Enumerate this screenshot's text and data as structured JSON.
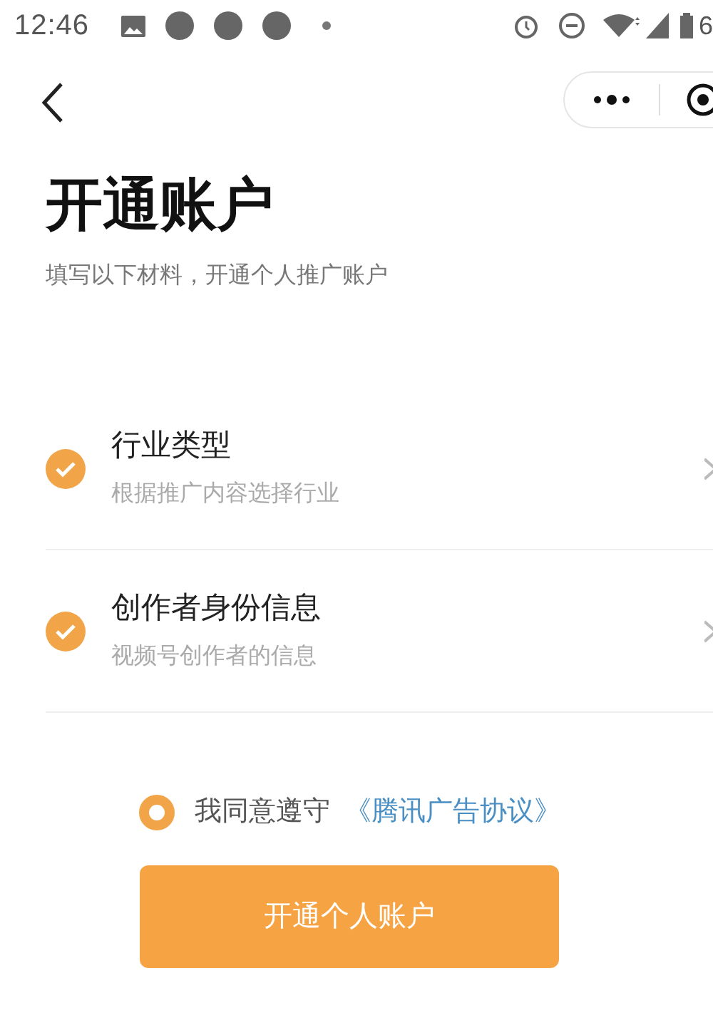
{
  "status_bar": {
    "time": "12:46",
    "battery_text": "6"
  },
  "header": {
    "title": "开通账户",
    "subtitle": "填写以下材料，开通个人推广账户"
  },
  "items": [
    {
      "title": "行业类型",
      "description": "根据推广内容选择行业",
      "checked": true
    },
    {
      "title": "创作者身份信息",
      "description": "视频号创作者的信息",
      "checked": true
    }
  ],
  "agreement": {
    "text": "我同意遵守",
    "link": "《腾讯广告协议》",
    "selected": false
  },
  "submit_button": {
    "label": "开通个人账户"
  }
}
